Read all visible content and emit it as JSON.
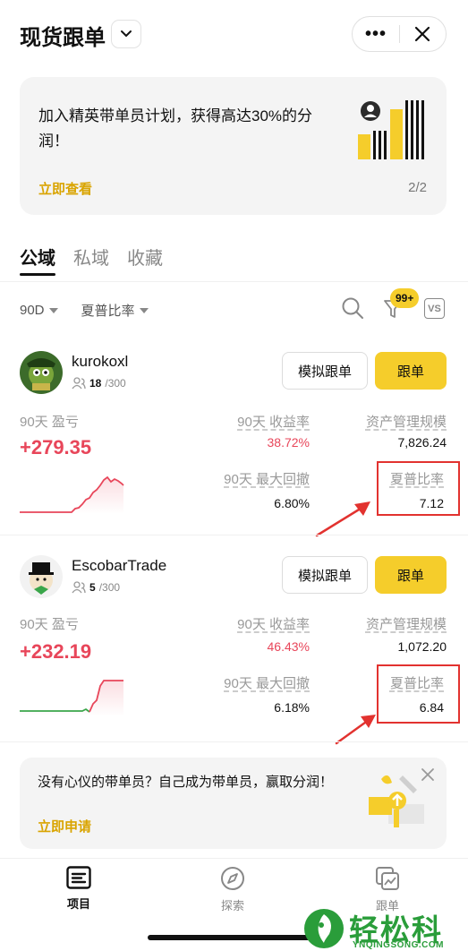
{
  "header": {
    "title": "现货跟单",
    "more_label": "•••"
  },
  "banner": {
    "text": "加入精英带单员计划，获得高达30%的分润！",
    "link": "立即查看",
    "page": "2/2"
  },
  "tabs": [
    "公域",
    "私域",
    "收藏"
  ],
  "filters": {
    "period": "90D",
    "sort": "夏普比率"
  },
  "toolbar": {
    "badge": "99+",
    "vs_label": "VS"
  },
  "traders": [
    {
      "name": "kurokoxl",
      "followers": "18",
      "followers_max": "/300",
      "sim_label": "模拟跟单",
      "follow_label": "跟单",
      "pnl_label": "90天 盈亏",
      "pnl": "+279.35",
      "roi_label": "90天 收益率",
      "roi": "38.72%",
      "aum_label": "资产管理规模",
      "aum": "7,826.24",
      "mdd_label": "90天 最大回撤",
      "mdd": "6.80%",
      "sharpe_label": "夏普比率",
      "sharpe": "7.12"
    },
    {
      "name": "EscobarTrade",
      "followers": "5",
      "followers_max": "/300",
      "sim_label": "模拟跟单",
      "follow_label": "跟单",
      "pnl_label": "90天 盈亏",
      "pnl": "+232.19",
      "roi_label": "90天 收益率",
      "roi": "46.43%",
      "aum_label": "资产管理规模",
      "aum": "1,072.20",
      "mdd_label": "90天 最大回撤",
      "mdd": "6.18%",
      "sharpe_label": "夏普比率",
      "sharpe": "6.84"
    }
  ],
  "promo": {
    "text": "没有心仪的带单员？自己成为带单员，赢取分润！",
    "link": "立即申请"
  },
  "nav": [
    {
      "label": "项目",
      "icon": "list-icon"
    },
    {
      "label": "探索",
      "icon": "compass-icon"
    },
    {
      "label": "跟单",
      "icon": "copy-chart-icon"
    }
  ],
  "watermark": {
    "text": "轻松科技",
    "sub": "YNQINGSONG.COM"
  },
  "colors": {
    "accent": "#f5cd2b",
    "profit": "#e8465a",
    "highlight": "#e2322f"
  }
}
